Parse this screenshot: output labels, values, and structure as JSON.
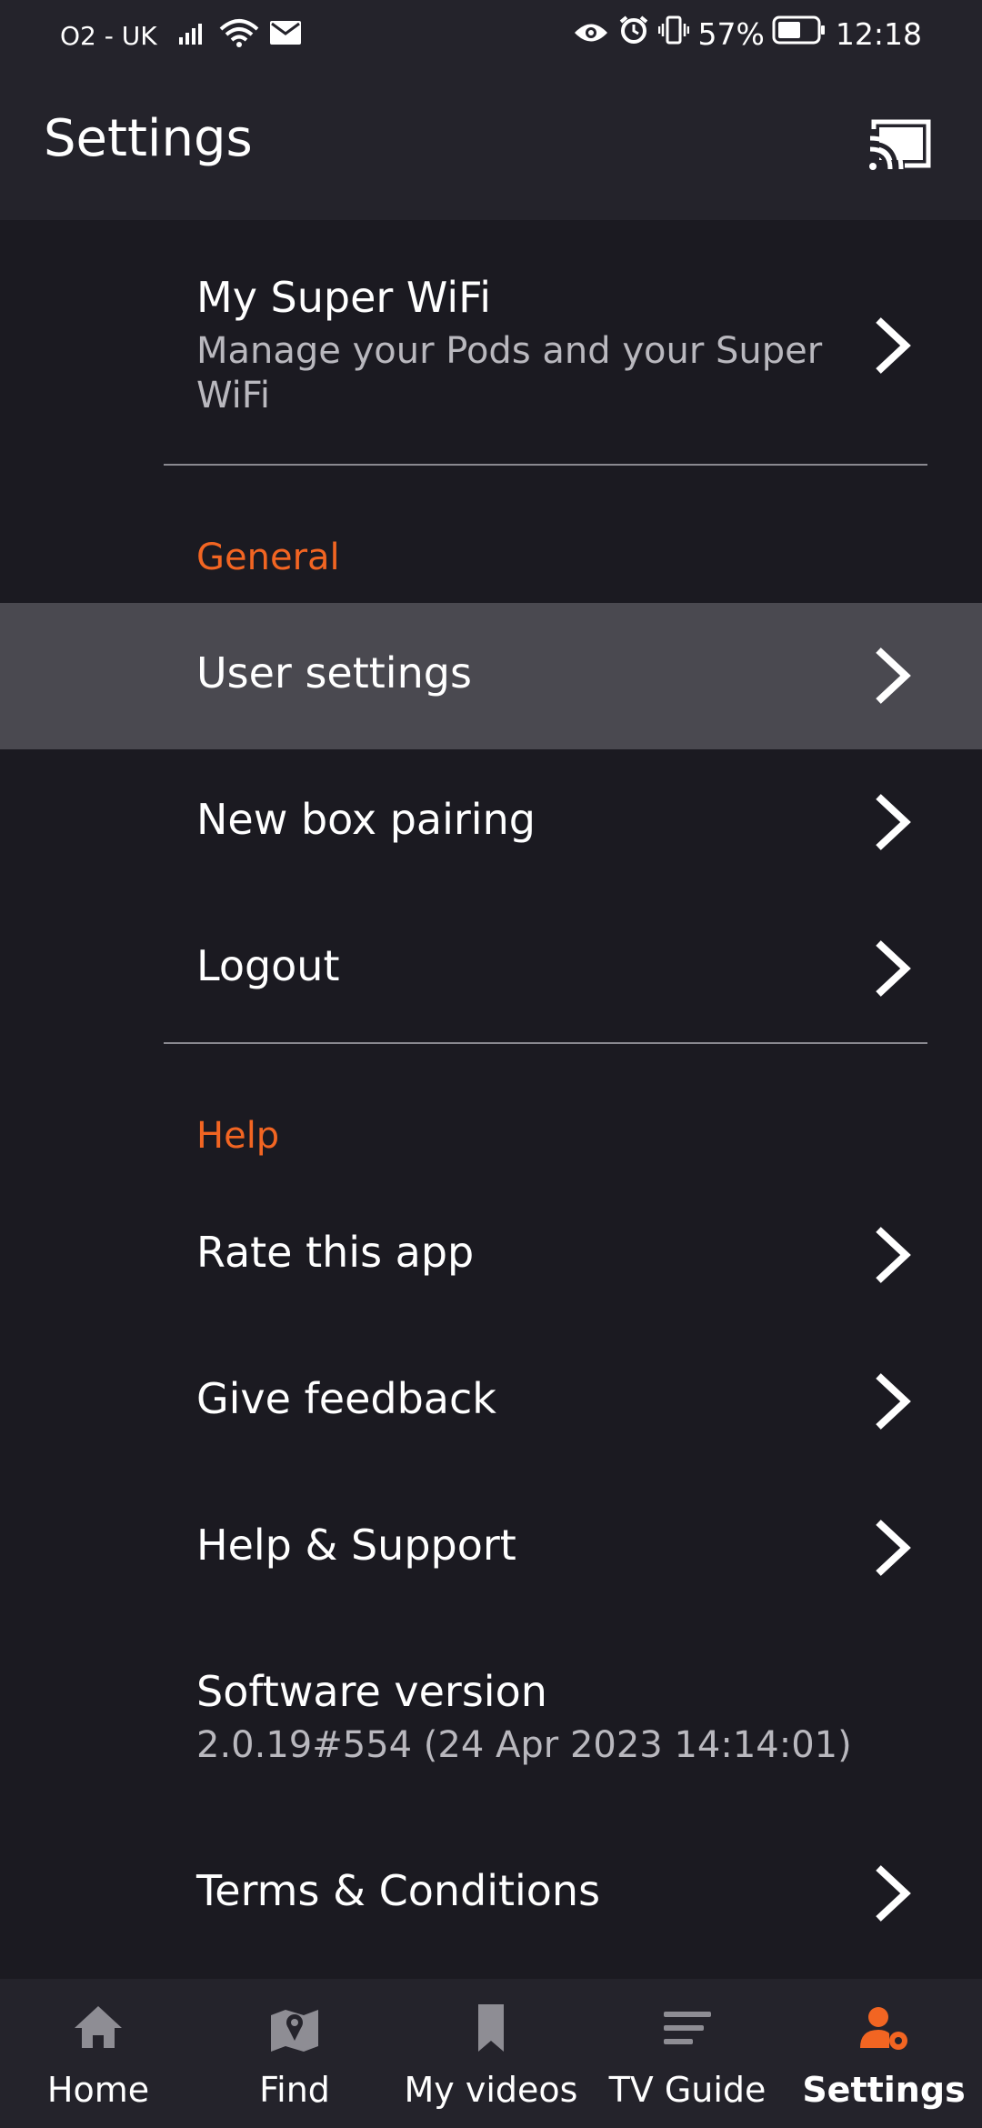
{
  "status_bar": {
    "carrier": "O2 - UK",
    "battery": "57%",
    "time": "12:18",
    "icons": [
      "signal-icon",
      "wifi-icon",
      "mail-icon",
      "eye-icon",
      "alarm-icon",
      "vibrate-icon",
      "battery-icon"
    ]
  },
  "header": {
    "title": "Settings",
    "cast_icon": "cast-icon"
  },
  "super_wifi": {
    "label": "My Super WiFi",
    "sub_line1": "Manage your Pods and your Super",
    "sub_line2": "WiFi"
  },
  "sections": {
    "general": "General",
    "help": "Help"
  },
  "general_items": {
    "user_settings": "User settings",
    "new_box_pairing": "New box pairing",
    "logout": "Logout"
  },
  "help_items": {
    "rate": "Rate this app",
    "feedback": "Give feedback",
    "support": "Help & Support",
    "software_version_label": "Software version",
    "software_version_value": "2.0.19#554 (24 Apr 2023 14:14:01)",
    "terms": "Terms & Conditions"
  },
  "bottom_nav": {
    "home": "Home",
    "find": "Find",
    "my_videos": "My videos",
    "tv_guide": "TV Guide",
    "settings": "Settings",
    "active_color": "#f26522"
  },
  "colors": {
    "accent": "#f26522",
    "background": "#1b1a21",
    "highlight": "#4a4950"
  }
}
